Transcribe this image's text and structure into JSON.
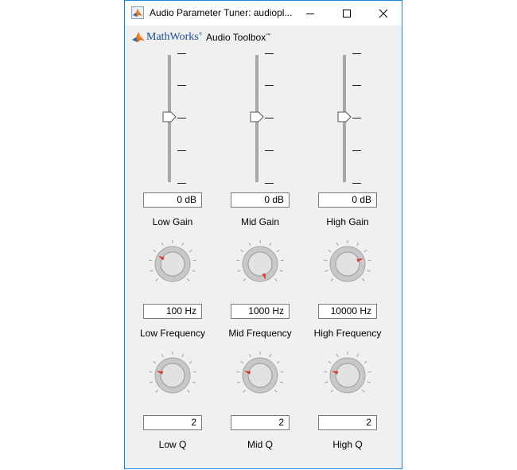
{
  "window": {
    "title": "Audio Parameter Tuner: audiopl...",
    "brand_mathworks": "MathWorks",
    "brand_reg": "®",
    "brand_toolbox": "Audio Toolbox",
    "brand_tm": "™"
  },
  "sliders": [
    {
      "value": "0 dB",
      "label": "Low Gain"
    },
    {
      "value": "0 dB",
      "label": "Mid Gain"
    },
    {
      "value": "0 dB",
      "label": "High Gain"
    }
  ],
  "frequency_knobs": [
    {
      "value": "100 Hz",
      "label": "Low Frequency"
    },
    {
      "value": "1000 Hz",
      "label": "Mid Frequency"
    },
    {
      "value": "10000 Hz",
      "label": "High Frequency"
    }
  ],
  "q_knobs": [
    {
      "value": "2",
      "label": "Low Q"
    },
    {
      "value": "2",
      "label": "Mid Q"
    },
    {
      "value": "2",
      "label": "High Q"
    }
  ],
  "colors": {
    "accent_border": "#1883d7",
    "pointer": "#d73a2e",
    "track": "#a8a8a8",
    "knob_fill": "#c8c8c8"
  },
  "icons": {
    "app": "matlab-membrane-icon",
    "minimize": "minimize-icon",
    "maximize": "maximize-icon",
    "close": "close-icon"
  }
}
